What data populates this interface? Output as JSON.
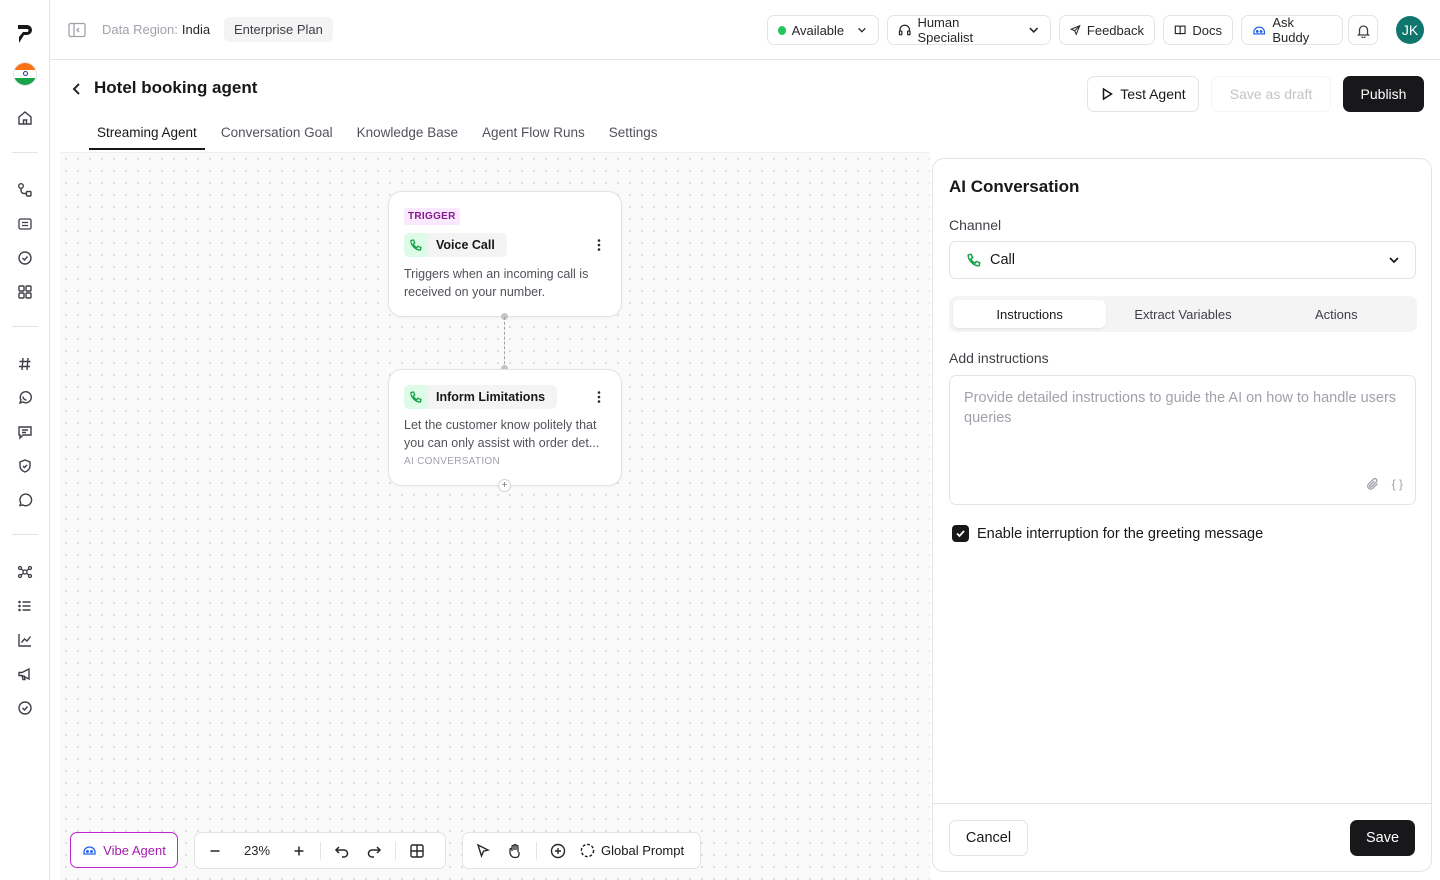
{
  "rail": {
    "logo_icon": "brand-logo-icon",
    "items": [
      "home-icon",
      "workflow-icon",
      "sip-icon",
      "check-circle-icon",
      "grid-icon",
      "hash-icon",
      "whatsapp-icon",
      "message-square-icon",
      "shield-icon",
      "chat-bubble-icon",
      "integrations-icon",
      "list-icon",
      "chart-icon",
      "megaphone-icon",
      "verified-icon"
    ]
  },
  "topbar": {
    "region_label": "Data Region:",
    "region_value": "India",
    "plan": "Enterprise Plan",
    "status": "Available",
    "specialist": "Human Specialist",
    "feedback": "Feedback",
    "docs": "Docs",
    "ask_buddy": "Ask Buddy",
    "avatar_initials": "JK"
  },
  "header": {
    "title": "Hotel booking agent",
    "test_agent": "Test Agent",
    "save_draft": "Save as draft",
    "publish": "Publish"
  },
  "tabs": [
    "Streaming Agent",
    "Conversation Goal",
    "Knowledge Base",
    "Agent Flow Runs",
    "Settings"
  ],
  "flow": {
    "trigger": {
      "badge": "TRIGGER",
      "title": "Voice Call",
      "description": "Triggers when an incoming call is received on your number."
    },
    "step": {
      "title": "Inform Limitations",
      "description": "Let the customer know politely that you can only assist with order det...",
      "type": "AI CONVERSATION"
    }
  },
  "toolbar": {
    "vibe_agent": "Vibe Agent",
    "zoom": "23%",
    "global_prompt": "Global Prompt"
  },
  "panel": {
    "title": "AI Conversation",
    "channel_label": "Channel",
    "channel_value": "Call",
    "segments": [
      "Instructions",
      "Extract Variables",
      "Actions"
    ],
    "instructions_label": "Add instructions",
    "instructions_placeholder": "Provide detailed instructions to guide the AI on how to handle users queries",
    "variable_icon_text": "{ }",
    "interruption_label": "Enable interruption for the greeting message",
    "cancel": "Cancel",
    "save": "Save"
  },
  "colors": {
    "primary": "#18181b",
    "accent_green": "#16a34a",
    "vibe_purple": "#a21caf",
    "trigger_badge_bg": "#fae8ff"
  }
}
